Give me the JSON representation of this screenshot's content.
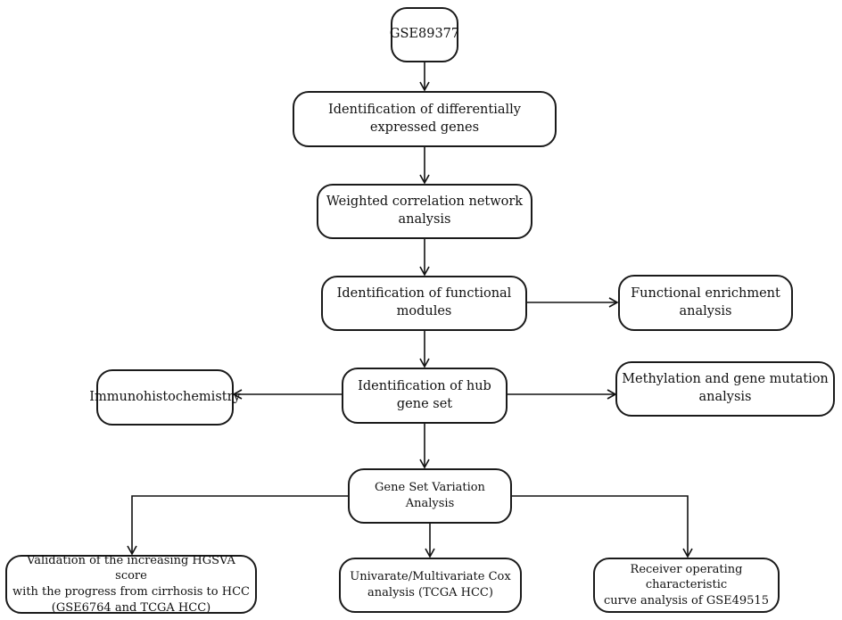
{
  "diagram": {
    "type": "flowchart",
    "nodes": {
      "start": "GSE89377",
      "deg": "Identification of differentially expressed genes",
      "wgcna": "Weighted correlation network analysis",
      "modules": "Identification of functional modules",
      "enrichment": "Functional enrichment analysis",
      "hub": "Identification of hub gene set",
      "ihc": "Immunohistochemistry",
      "methylation": "Methylation and gene mutation analysis",
      "gsva": "Gene Set Variation Analysis",
      "validation_line1": "Validation of the increasing HGSVA score",
      "validation_line2": "with the progress from cirrhosis to HCC",
      "validation_line3": "(GSE6764 and TCGA HCC)",
      "cox_line1": "Univarate/Multivariate Cox",
      "cox_line2": "analysis (TCGA HCC)",
      "roc_line1": "Receiver operating characteristic",
      "roc_line2": "curve analysis of GSE49515"
    },
    "edges": [
      [
        "start",
        "deg"
      ],
      [
        "deg",
        "wgcna"
      ],
      [
        "wgcna",
        "modules"
      ],
      [
        "modules",
        "enrichment"
      ],
      [
        "modules",
        "hub"
      ],
      [
        "hub",
        "ihc"
      ],
      [
        "hub",
        "methylation"
      ],
      [
        "hub",
        "gsva"
      ],
      [
        "gsva",
        "validation"
      ],
      [
        "gsva",
        "cox"
      ],
      [
        "gsva",
        "roc"
      ]
    ]
  }
}
